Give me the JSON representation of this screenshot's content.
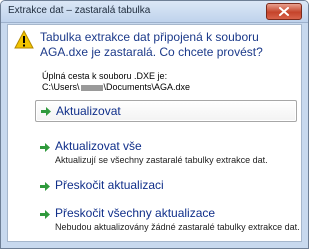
{
  "window": {
    "title": "Extrakce dat – zastaralá tabulka",
    "close_icon": "close-icon"
  },
  "dialog": {
    "icon": "warning-icon",
    "heading": "Tabulka extrakce dat připojená k souboru AGA.dxe je zastaralá. Co chcete provést?",
    "path_label": "Úplná cesta k souboru .DXE je:",
    "path_prefix": "C:\\Users\\",
    "path_suffix": "\\Documents\\AGA.dxe"
  },
  "options": [
    {
      "label": "Aktualizovat",
      "description": "",
      "icon": "arrow-right-icon",
      "selected": true
    },
    {
      "label": "Aktualizovat vše",
      "description": "Aktualizují se všechny zastaralé tabulky extrakce dat.",
      "icon": "arrow-right-icon"
    },
    {
      "label": "Přeskočit aktualizaci",
      "description": "",
      "icon": "arrow-right-icon"
    },
    {
      "label": "Přeskočit všechny aktualizace",
      "description": "Nebudou aktualizovány žádné zastaralé tabulky extrakce dat.",
      "icon": "arrow-right-icon"
    }
  ],
  "colors": {
    "heading_text": "#1c3a8a",
    "arrow_green": "#2f9a3c",
    "close_red": "#c5442b"
  }
}
